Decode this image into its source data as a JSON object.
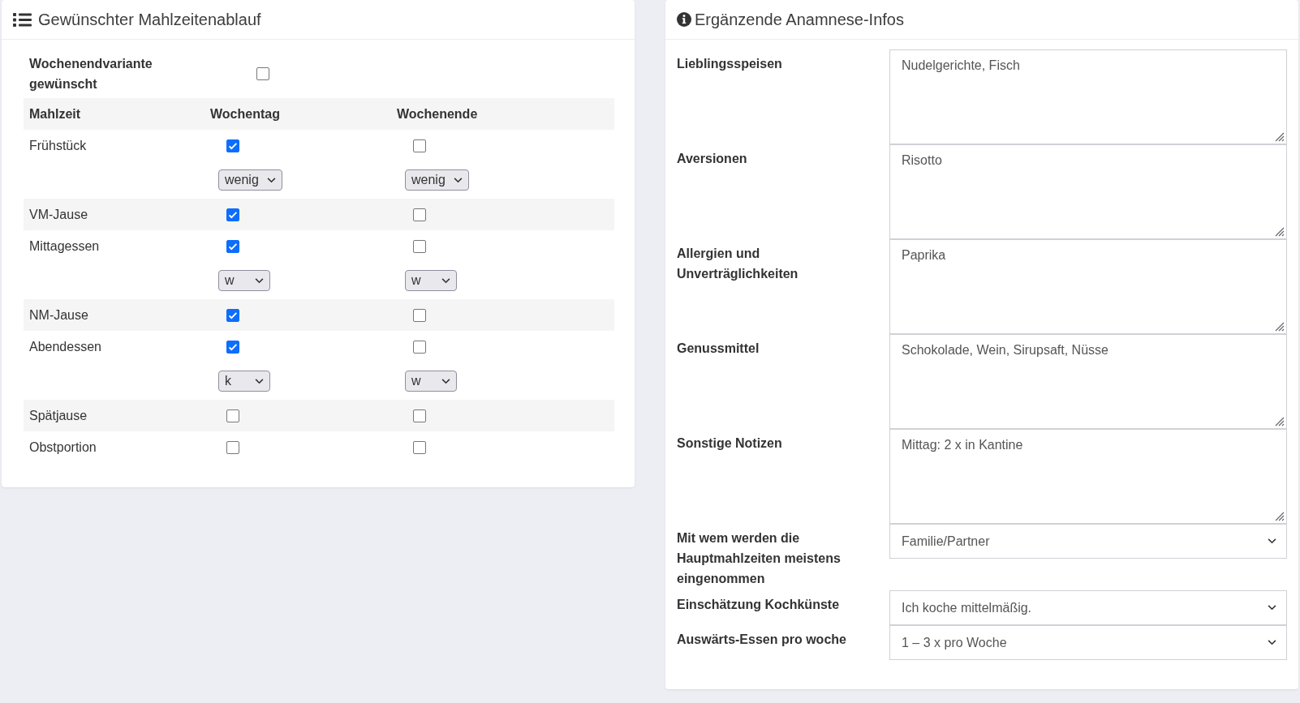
{
  "meal_plan": {
    "title": "Gewünschter Mahlzeitenablauf",
    "weekend_variant": {
      "label": "Wochenendvariante gewünscht",
      "checked": false
    },
    "columns": [
      "Mahlzeit",
      "Wochentag",
      "Wochenende"
    ],
    "meals": [
      {
        "name": "Frühstück",
        "weekday": {
          "checked": true,
          "portion": "wenig"
        },
        "weekend": {
          "checked": false,
          "portion": "wenig"
        }
      },
      {
        "name": "VM-Jause",
        "weekday": {
          "checked": true
        },
        "weekend": {
          "checked": false
        }
      },
      {
        "name": "Mittagessen",
        "weekday": {
          "checked": true,
          "portion": "w"
        },
        "weekend": {
          "checked": false,
          "portion": "w"
        }
      },
      {
        "name": "NM-Jause",
        "weekday": {
          "checked": true
        },
        "weekend": {
          "checked": false
        }
      },
      {
        "name": "Abendessen",
        "weekday": {
          "checked": true,
          "portion": "k"
        },
        "weekend": {
          "checked": false,
          "portion": "w"
        }
      },
      {
        "name": "Spätjause",
        "weekday": {
          "checked": false
        },
        "weekend": {
          "checked": false
        }
      },
      {
        "name": "Obstportion",
        "weekday": {
          "checked": false
        },
        "weekend": {
          "checked": false
        }
      }
    ]
  },
  "anamnesis": {
    "title": "Ergänzende Anamnese-Infos",
    "fields": [
      {
        "kind": "textarea",
        "label": "Lieblingsspeisen",
        "value": "Nudelgerichte, Fisch"
      },
      {
        "kind": "textarea",
        "label": "Aversionen",
        "value": "Risotto"
      },
      {
        "kind": "textarea",
        "label": "Allergien und Unverträglichkeiten",
        "value": "Paprika"
      },
      {
        "kind": "textarea",
        "label": "Genussmittel",
        "value": "Schokolade, Wein, Sirupsaft, Nüsse"
      },
      {
        "kind": "textarea",
        "label": "Sonstige Notizen",
        "value": "Mittag: 2 x in Kantine"
      },
      {
        "kind": "select",
        "label": "Mit wem werden die Hauptmahlzeiten meistens eingenommen",
        "value": "Familie/Partner"
      },
      {
        "kind": "select",
        "label": "Einschätzung Kochkünste",
        "value": "Ich koche mittelmäßig."
      },
      {
        "kind": "select",
        "label": "Auswärts-Essen pro woche",
        "value": "1 – 3 x pro Woche"
      }
    ]
  }
}
